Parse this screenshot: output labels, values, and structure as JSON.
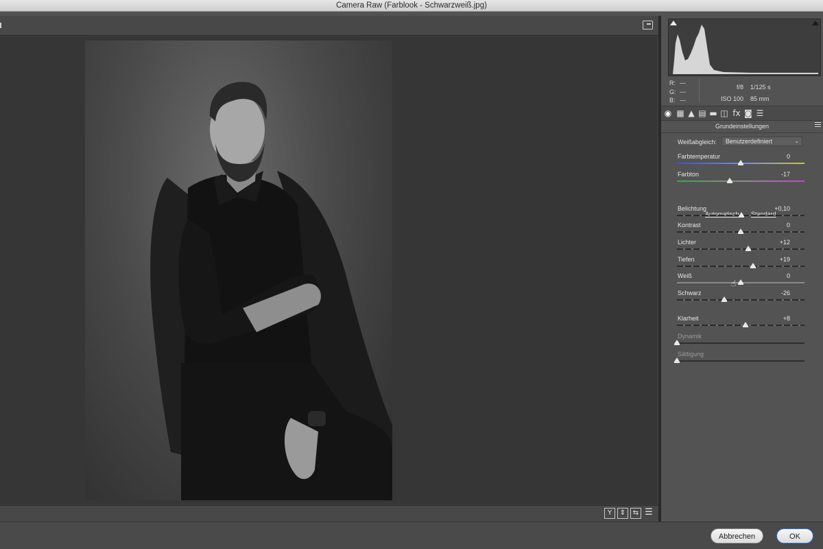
{
  "window": {
    "title": "Camera Raw (Farblook - Schwarzweiß.jpg)"
  },
  "preview": {
    "footer_icons": [
      "Y",
      "⇕",
      "⇆",
      "☰"
    ]
  },
  "info": {
    "r_label": "R:",
    "g_label": "G:",
    "b_label": "B:",
    "r_value": "---",
    "g_value": "---",
    "b_value": "---",
    "aperture": "f/8",
    "shutter": "1/125 s",
    "iso": "ISO 100",
    "focal_length": "85 mm"
  },
  "panel": {
    "section_title": "Grundeinstellungen",
    "tab_icons": [
      "◉",
      "▦",
      "▲",
      "▤",
      "▬",
      "◫",
      "fx",
      "◙",
      "☰"
    ],
    "white_balance": {
      "label": "Weißabgleich:",
      "selected": "Benutzerdefiniert"
    },
    "auto_link": "Automatisch",
    "default_link": "Standard",
    "sliders": [
      {
        "key": "temp",
        "label": "Farbtemperatur",
        "value": "0",
        "position": 0.5,
        "track": "temp",
        "disabled": false
      },
      {
        "key": "tint",
        "label": "Farbton",
        "value": "-17",
        "position": 0.415,
        "track": "tint",
        "disabled": false
      },
      {
        "key": "exposure",
        "label": "Belichtung",
        "value": "+0,10",
        "position": 0.505,
        "track": "dashed",
        "disabled": false
      },
      {
        "key": "contrast",
        "label": "Kontrast",
        "value": "0",
        "position": 0.5,
        "track": "dashed",
        "disabled": false
      },
      {
        "key": "highlights",
        "label": "Lichter",
        "value": "+12",
        "position": 0.56,
        "track": "dashed",
        "disabled": false
      },
      {
        "key": "shadows",
        "label": "Tiefen",
        "value": "+19",
        "position": 0.595,
        "track": "dashed",
        "disabled": false
      },
      {
        "key": "whites",
        "label": "Weiß",
        "value": "0",
        "position": 0.5,
        "track": "light",
        "disabled": false
      },
      {
        "key": "blacks",
        "label": "Schwarz",
        "value": "-26",
        "position": 0.37,
        "track": "dashed",
        "disabled": false
      },
      {
        "key": "clarity",
        "label": "Klarheit",
        "value": "+8",
        "position": 0.54,
        "track": "dashed",
        "disabled": false
      },
      {
        "key": "vibrance",
        "label": "Dynamik",
        "value": "",
        "position": 0.0,
        "track": "plain",
        "disabled": true
      },
      {
        "key": "saturation",
        "label": "Sättigung",
        "value": "",
        "position": 0.0,
        "track": "plain",
        "disabled": true
      }
    ]
  },
  "buttons": {
    "cancel": "Abbrechen",
    "ok": "OK"
  }
}
